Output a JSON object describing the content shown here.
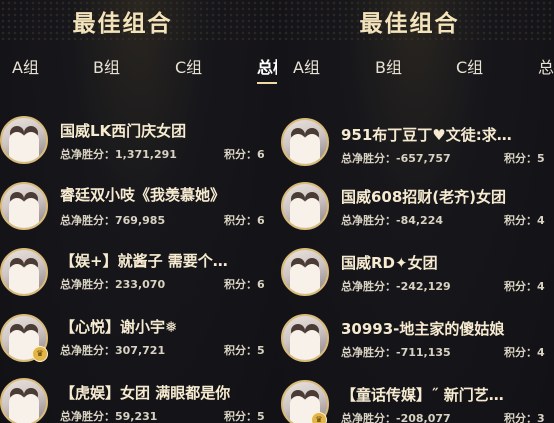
{
  "panels": [
    {
      "title": "最佳组合",
      "tabs": [
        "A组",
        "B组",
        "C组",
        "总榜"
      ],
      "active_tab": 3,
      "rows": [
        {
          "name": "国威LK西门庆女团",
          "stat": "总净胜分：1,371,291",
          "score": "积分：6",
          "badge": false
        },
        {
          "name": "睿廷双小吱《我羡慕她》",
          "stat": "总净胜分：769,985",
          "score": "积分：6",
          "badge": false
        },
        {
          "name": "【娱+】就酱子 需要个…",
          "stat": "总净胜分：233,070",
          "score": "积分：6",
          "badge": false
        },
        {
          "name": "【心悦】谢小宇❅",
          "stat": "总净胜分：307,721",
          "score": "积分：5",
          "badge": true
        },
        {
          "name": "【虎娱】女团 满眼都是你",
          "stat": "总净胜分：59,231",
          "score": "积分：5",
          "badge": false
        }
      ]
    },
    {
      "title": "最佳组合",
      "tabs": [
        "A组",
        "B组",
        "C组",
        "总榜"
      ],
      "active_tab": 0,
      "rows": [
        {
          "name": "951布丁豆丁♥文徒:求…",
          "stat": "总净胜分：-657,757",
          "score": "积分：5",
          "badge": false
        },
        {
          "name": "国威608招财(老齐)女团",
          "stat": "总净胜分：-84,224",
          "score": "积分：4",
          "badge": false
        },
        {
          "name": "国威RD✦女团",
          "stat": "总净胜分：-242,129",
          "score": "积分：4",
          "badge": false
        },
        {
          "name": "30993-地主家的傻姑娘",
          "stat": "总净胜分：-711,135",
          "score": "积分：4",
          "badge": false
        },
        {
          "name": "【童话传媒】˝ 新门艺…",
          "stat": "总净胜分：-208,077",
          "score": "积分：3",
          "badge": true
        }
      ]
    }
  ]
}
